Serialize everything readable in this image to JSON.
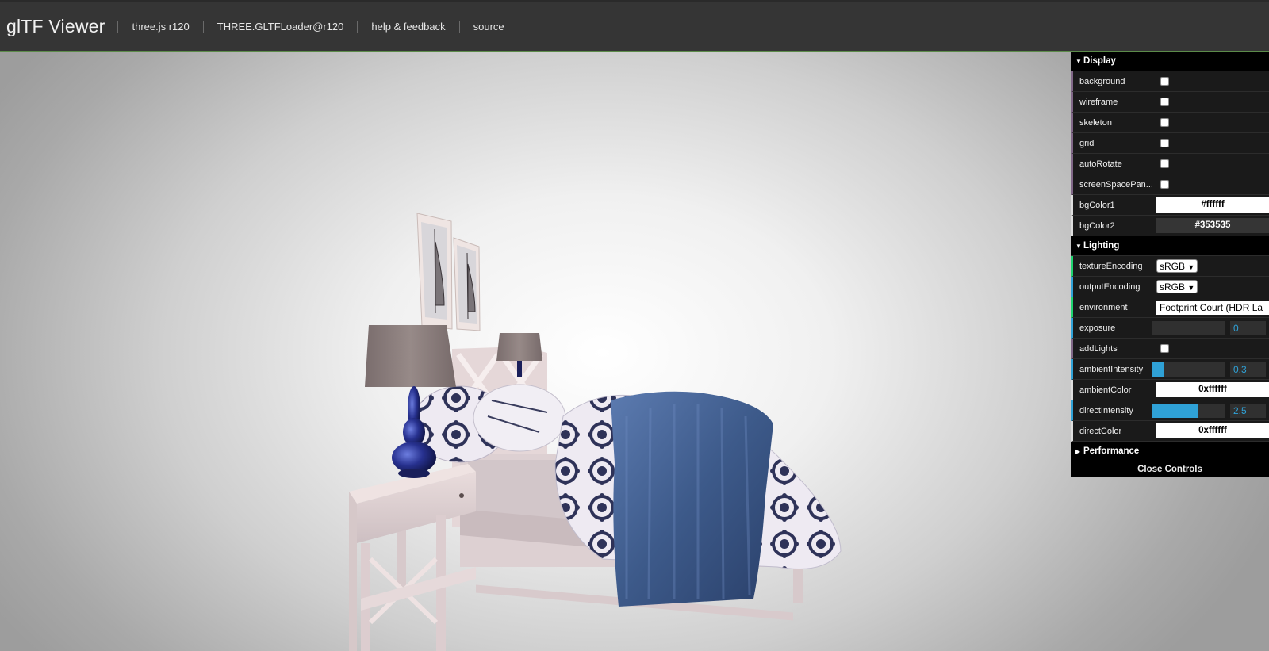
{
  "header": {
    "title": "glTF Viewer",
    "links": [
      "three.js r120",
      "THREE.GLTFLoader@r120",
      "help & feedback",
      "source"
    ]
  },
  "gui": {
    "display": {
      "title": "Display",
      "rows": {
        "background": {
          "label": "background",
          "checked": false
        },
        "wireframe": {
          "label": "wireframe",
          "checked": false
        },
        "skeleton": {
          "label": "skeleton",
          "checked": false
        },
        "grid": {
          "label": "grid",
          "checked": false
        },
        "autoRotate": {
          "label": "autoRotate",
          "checked": false
        },
        "screenSpacePanning": {
          "label": "screenSpacePan...",
          "checked": false
        },
        "bgColor1": {
          "label": "bgColor1",
          "value": "#ffffff",
          "color": "#ffffff"
        },
        "bgColor2": {
          "label": "bgColor2",
          "value": "#353535",
          "color": "#353535"
        }
      }
    },
    "lighting": {
      "title": "Lighting",
      "rows": {
        "textureEncoding": {
          "label": "textureEncoding",
          "value": "sRGB"
        },
        "outputEncoding": {
          "label": "outputEncoding",
          "value": "sRGB"
        },
        "environment": {
          "label": "environment",
          "value": "Footprint Court (HDR La"
        },
        "exposure": {
          "label": "exposure",
          "value": "0",
          "fill": 0.0
        },
        "addLights": {
          "label": "addLights",
          "checked": false
        },
        "ambientIntensity": {
          "label": "ambientIntensity",
          "value": "0.3",
          "fill": 0.15
        },
        "ambientColor": {
          "label": "ambientColor",
          "value": "0xffffff",
          "color": "#ffffff"
        },
        "directIntensity": {
          "label": "directIntensity",
          "value": "2.5",
          "fill": 0.625
        },
        "directColor": {
          "label": "directColor",
          "value": "0xffffff",
          "color": "#ffffff"
        }
      }
    },
    "performance": {
      "title": "Performance"
    },
    "close_label": "Close Controls"
  },
  "colors": {
    "header_bg": "#353535",
    "panel_bg": "#1a1a1a",
    "number_accent": "#2fa1d6",
    "boolean_accent": "#806787",
    "string_accent": "#1ed36f",
    "fabric_blue": "#3d5a8a"
  },
  "icons": {
    "expand": "triangle-down-icon",
    "collapse": "triangle-right-icon"
  }
}
